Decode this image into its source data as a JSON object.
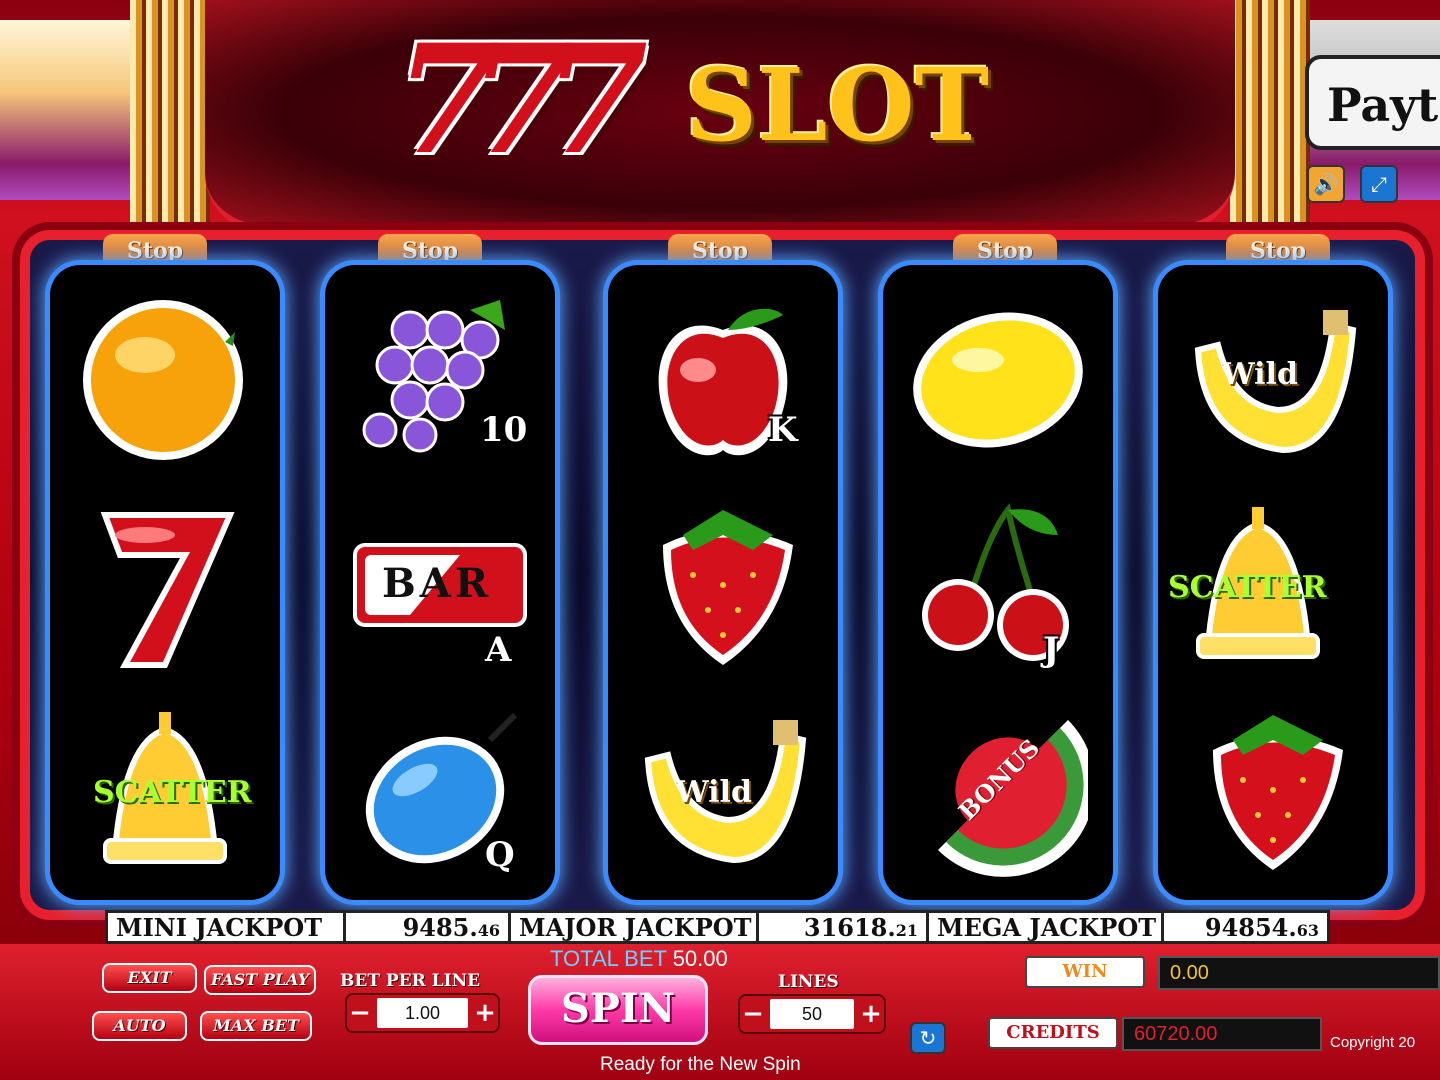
{
  "title": {
    "sevens": "777",
    "slot": "SLOT"
  },
  "paytable": "Payt",
  "icons": {
    "sound": "speaker-icon",
    "fullscreen": "fullscreen-icon",
    "autoplay": "refresh-icon"
  },
  "stop_label": "Stop",
  "reels": [
    {
      "symbols": [
        {
          "name": "orange",
          "label": ""
        },
        {
          "name": "seven",
          "label": ""
        },
        {
          "name": "bell-scatter",
          "label": "SCATTER"
        }
      ]
    },
    {
      "symbols": [
        {
          "name": "grapes",
          "label": "10"
        },
        {
          "name": "bar",
          "label": "A",
          "word": "BAR"
        },
        {
          "name": "plum",
          "label": "Q"
        }
      ]
    },
    {
      "symbols": [
        {
          "name": "apple",
          "label": "K"
        },
        {
          "name": "strawberry",
          "label": ""
        },
        {
          "name": "banana-wild",
          "label": "Wild"
        }
      ]
    },
    {
      "symbols": [
        {
          "name": "lemon",
          "label": ""
        },
        {
          "name": "cherries",
          "label": "J"
        },
        {
          "name": "watermelon-bonus",
          "label": "BONUS"
        }
      ]
    },
    {
      "symbols": [
        {
          "name": "banana-wild",
          "label": "Wild"
        },
        {
          "name": "bell-scatter",
          "label": "SCATTER"
        },
        {
          "name": "strawberry",
          "label": ""
        }
      ]
    }
  ],
  "jackpots": [
    {
      "name": "MINI JACKPOT",
      "value_main": "9485.",
      "value_cents": "46"
    },
    {
      "name": "MAJOR JACKPOT",
      "value_main": "31618.",
      "value_cents": "21"
    },
    {
      "name": "MEGA JACKPOT",
      "value_main": "94854.",
      "value_cents": "63"
    }
  ],
  "controls": {
    "exit": "EXIT",
    "fast_play": "FAST PLAY",
    "auto": "AUTO",
    "max_bet": "MAX BET",
    "bet_per_line_label": "BET PER LINE",
    "bet_per_line": "1.00",
    "minus": "−",
    "plus": "+",
    "total_bet_label": "TOTAL BET",
    "total_bet": "50.00",
    "spin": "SPIN",
    "lines_label": "LINES",
    "lines": "50",
    "win_label": "WIN",
    "win": "0.00",
    "credits_label": "CREDITS",
    "credits": "60720.00",
    "status": "Ready for the New Spin",
    "copyright": "Copyright 20"
  },
  "colors": {
    "accent_red": "#d0101e",
    "reel_glow": "#3a8bff",
    "gold": "#ffc21a",
    "spin_pink": "#ff3aa8"
  }
}
